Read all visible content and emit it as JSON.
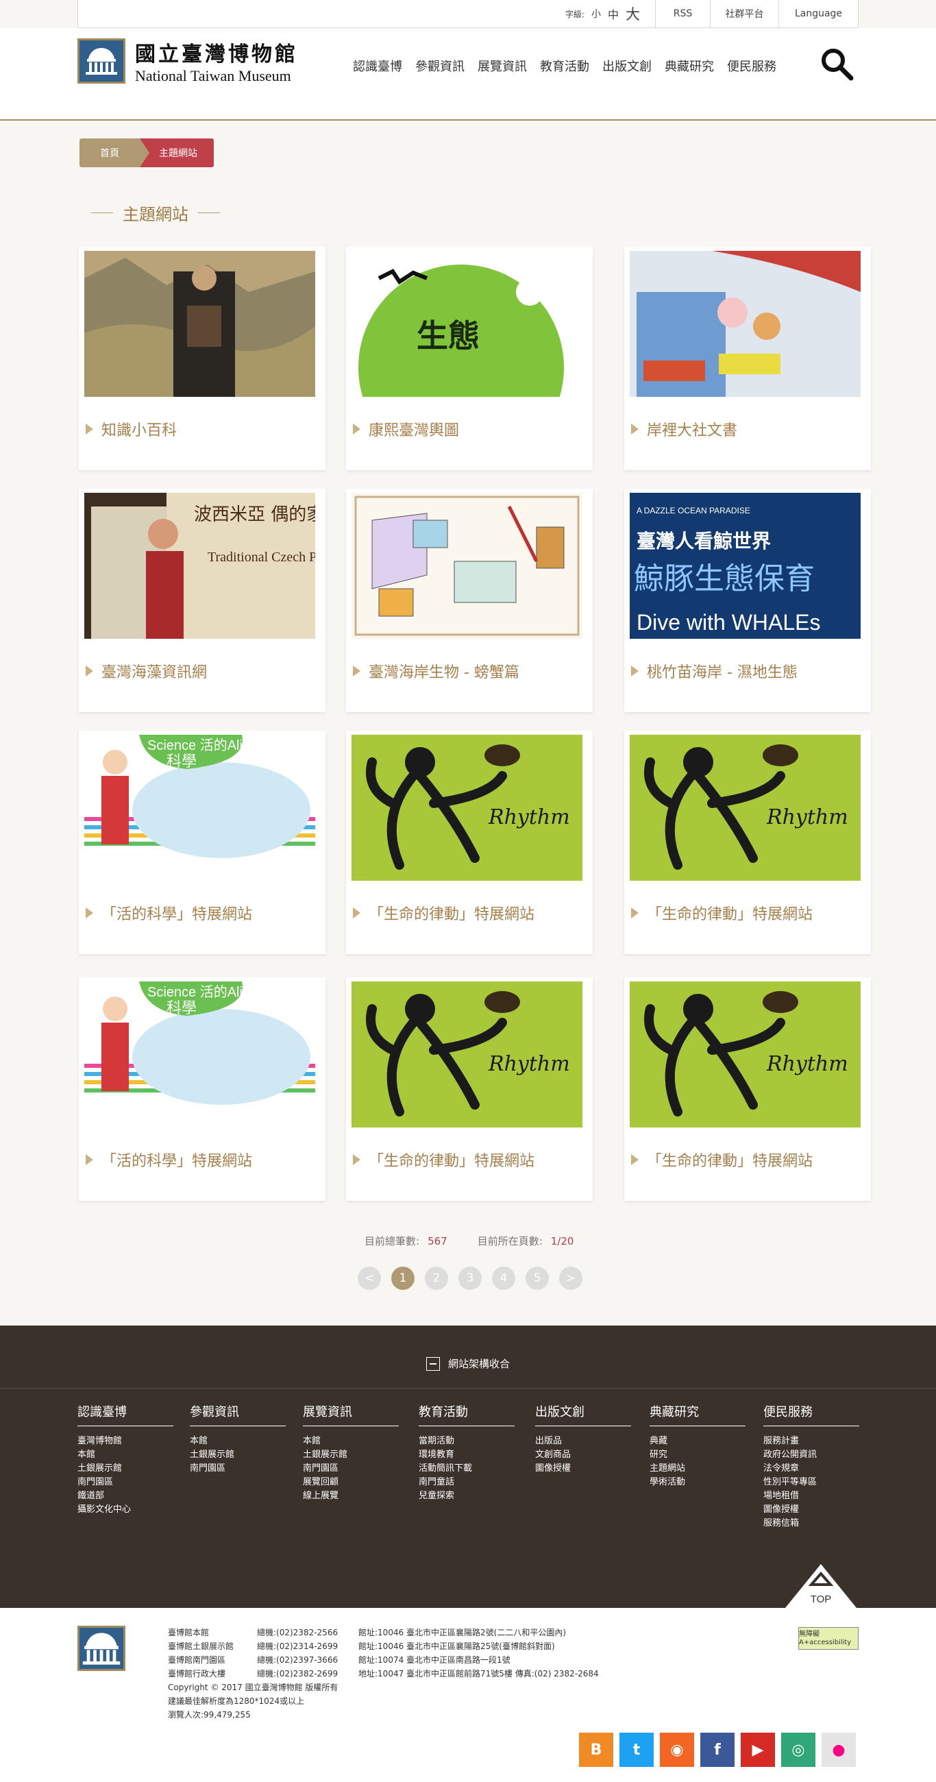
{
  "topbar": {
    "font_label": "字級:",
    "font_small": "小",
    "font_medium": "中",
    "font_large": "大",
    "rss": "RSS",
    "social": "社群平台",
    "language": "Language"
  },
  "logo": {
    "zh": "國立臺灣博物館",
    "en": "National Taiwan Museum"
  },
  "nav": [
    "認識臺博",
    "參觀資訊",
    "展覽資訊",
    "教育活動",
    "出版文創",
    "典藏研究",
    "便民服務"
  ],
  "breadcrumb": {
    "home": "首頁",
    "current": "主題網站"
  },
  "section_title": "主題網站",
  "cards": [
    {
      "caption": "知識小百科"
    },
    {
      "caption": "康熙臺灣輿圖"
    },
    {
      "caption": "岸裡大社文書"
    },
    {
      "caption": "臺灣海藻資訊網"
    },
    {
      "caption": "臺灣海岸生物 - 螃蟹篇"
    },
    {
      "caption": "桃竹苗海岸 - 濕地生態"
    },
    {
      "caption": "「活的科學」特展網站"
    },
    {
      "caption": "「生命的律動」特展網站"
    },
    {
      "caption": "「生命的律動」特展網站"
    },
    {
      "caption": "「活的科學」特展網站"
    },
    {
      "caption": "「生命的律動」特展網站"
    },
    {
      "caption": "「生命的律動」特展網站"
    }
  ],
  "image_text": {
    "puppets_title": "波西米亞 偶的家",
    "puppets_en": "Traditional Czech Puppets",
    "whale_small": "A DAZZLE OCEAN PARADISE",
    "whale_title": "臺灣人看鯨世界",
    "whale_big": "鯨豚生態保育",
    "whale_en": "Dive with WHALEs",
    "science_en": "Science 活的Alive",
    "science_zh": "科學",
    "rhythm": "Rhythm"
  },
  "stats": {
    "total_label": "目前總筆數:",
    "total": "567",
    "page_label": "目前所在頁數:",
    "page": "1/20"
  },
  "pager": {
    "prev": "<",
    "pages": [
      "1",
      "2",
      "3",
      "4",
      "5"
    ],
    "next": ">"
  },
  "footer": {
    "fold_label": "網站架構收合",
    "columns": [
      {
        "title": "認識臺博",
        "items": [
          "臺灣博物館",
          "本館",
          "土銀展示館",
          "南門園區",
          "鐵道部",
          "攝影文化中心"
        ]
      },
      {
        "title": "參觀資訊",
        "items": [
          "本館",
          "土銀展示館",
          "南門園區"
        ]
      },
      {
        "title": "展覽資訊",
        "items": [
          "本館",
          "土銀展示館",
          "南門園區",
          "展覽回顧",
          "線上展覽"
        ]
      },
      {
        "title": "教育活動",
        "items": [
          "當期活動",
          "環境教育",
          "活動簡訊下載",
          "南門童話",
          "兒童探索"
        ]
      },
      {
        "title": "出版文創",
        "items": [
          "出版品",
          "文創商品",
          "圖像授權"
        ]
      },
      {
        "title": "典藏研究",
        "items": [
          "典藏",
          "研究",
          "主題網站",
          "學術活動"
        ]
      },
      {
        "title": "便民服務",
        "items": [
          "服務計畫",
          "政府公開資訊",
          "法令規章",
          "性別平等專區",
          "場地租借",
          "圖像授權",
          "服務信箱"
        ]
      }
    ],
    "top": "TOP"
  },
  "bottom": {
    "rows": [
      [
        "臺博館本館",
        "總機:(02)2382-2566",
        "館址:10046 臺北市中正區襄陽路2號(二二八和平公園內)"
      ],
      [
        "臺博館土銀展示館",
        "總機:(02)2314-2699",
        "館址:10046 臺北市中正區襄陽路25號(臺博館斜對面)"
      ],
      [
        "臺博館南門園區",
        "總機:(02)2397-3666",
        "館址:10074 臺北市中正區南昌路一段1號"
      ],
      [
        "臺博館行政大樓",
        "總機:(02)2382-2699",
        "地址:10047 臺北市中正區館前路71號5樓  傳真:(02) 2382-2684"
      ]
    ],
    "copyright": "Copyright © 2017 國立臺灣博物館 版權所有",
    "resolution": "建議最佳解析度為1280*1024或以上",
    "visits": "瀏覽人次:99,479,255",
    "accessibility": "無障礙 A+accessibility"
  },
  "social_icons": [
    "blogger-icon",
    "twitter-icon",
    "rss-icon",
    "facebook-icon",
    "youtube-icon",
    "tripadvisor-icon",
    "flickr-icon"
  ]
}
